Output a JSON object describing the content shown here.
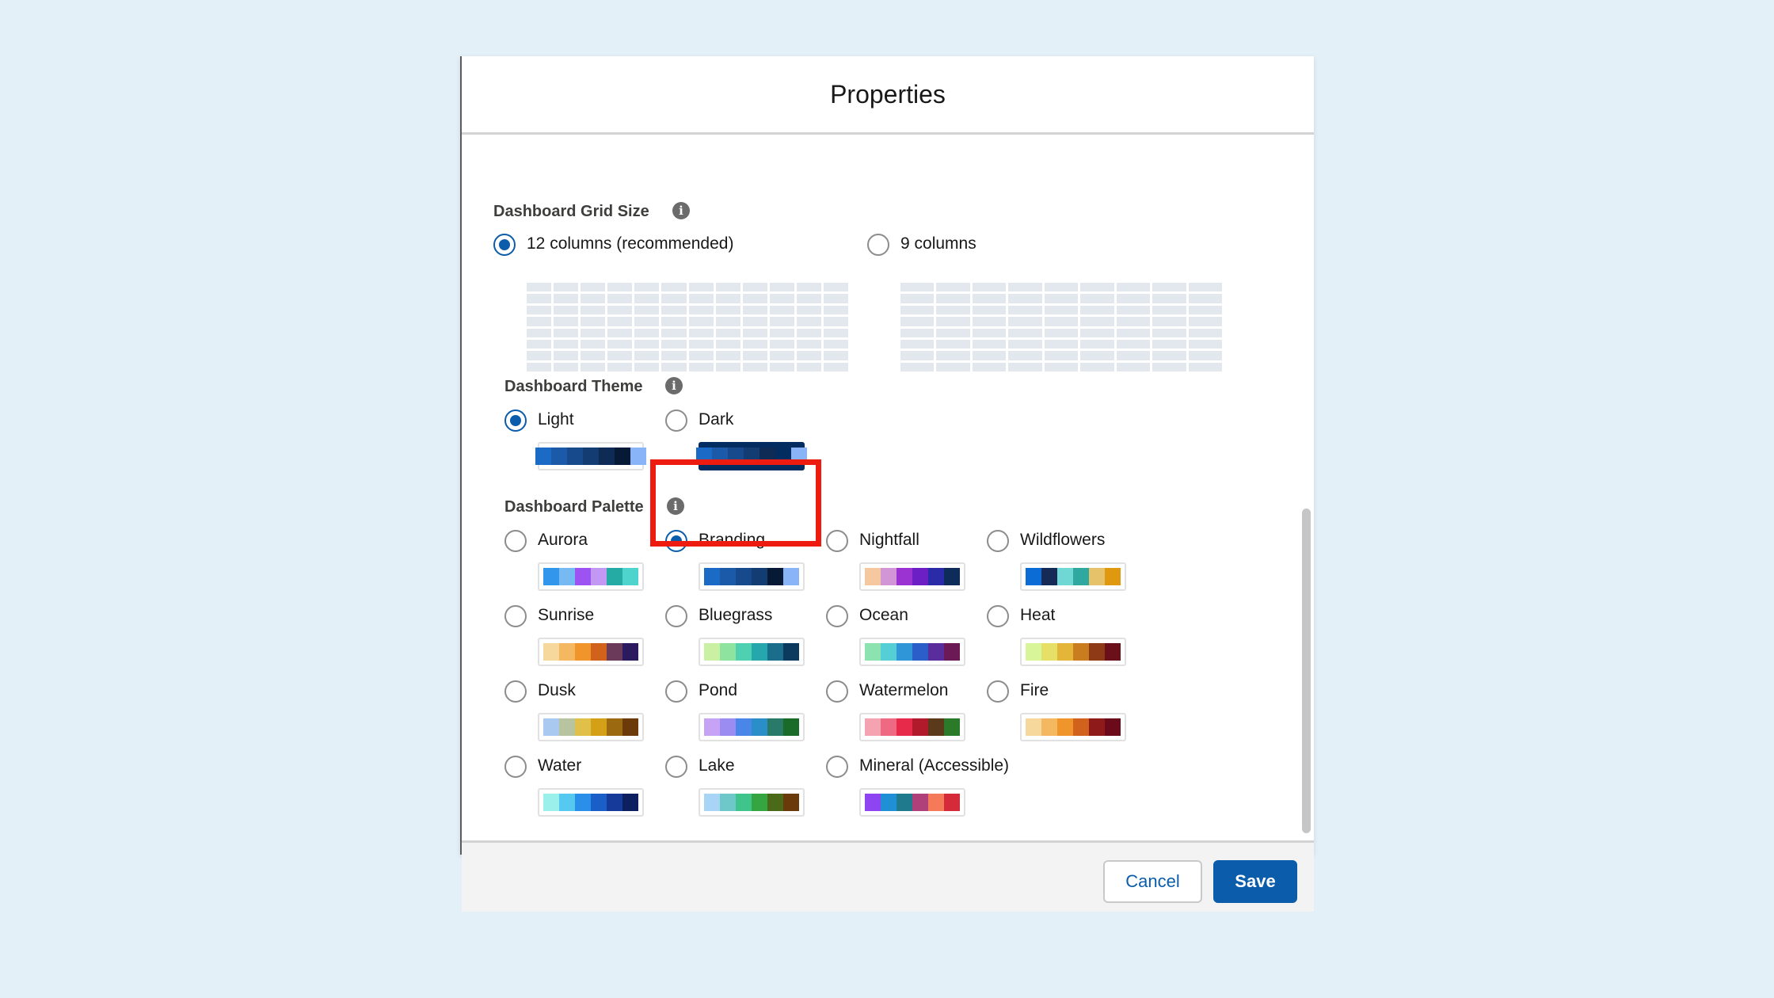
{
  "dialog": {
    "title": "Properties",
    "cancel_label": "Cancel",
    "save_label": "Save"
  },
  "grid_size": {
    "label": "Dashboard Grid Size",
    "info_icon": "info-icon",
    "options": [
      {
        "label": "12 columns (recommended)",
        "selected": true,
        "columns": 12
      },
      {
        "label": "9 columns",
        "selected": false,
        "columns": 9
      }
    ]
  },
  "theme": {
    "label": "Dashboard Theme",
    "options": [
      {
        "label": "Light",
        "selected": true,
        "colors": [
          "#1b6bc6",
          "#1a5aa8",
          "#164a8c",
          "#123c72",
          "#0d2b54",
          "#061a36",
          "#8ab4f8"
        ]
      },
      {
        "label": "Dark",
        "selected": false,
        "colors": [
          "#1b6bc6",
          "#1a5aa8",
          "#164a8c",
          "#123c72",
          "#0d2b54",
          "#032d60",
          "#8ab4f8"
        ]
      }
    ]
  },
  "palette": {
    "label": "Dashboard Palette",
    "options": [
      {
        "label": "Aurora",
        "selected": false,
        "colors": [
          "#3296ed",
          "#77b9f2",
          "#9d53f2",
          "#c398f5",
          "#26aba4",
          "#4ed4cd"
        ]
      },
      {
        "label": "Branding",
        "selected": true,
        "colors": [
          "#1b6bc6",
          "#1a5aa8",
          "#164a8c",
          "#123c72",
          "#061a36",
          "#8ab4f8"
        ]
      },
      {
        "label": "Nightfall",
        "selected": false,
        "colors": [
          "#f6c89f",
          "#d295d6",
          "#9b33d3",
          "#6b1fc4",
          "#2b2aa8",
          "#0e2c5a"
        ]
      },
      {
        "label": "Wildflowers",
        "selected": false,
        "colors": [
          "#0c6cd6",
          "#152a55",
          "#6fd8d4",
          "#2fa89f",
          "#e6c26b",
          "#e0990e"
        ]
      },
      {
        "label": "Sunrise",
        "selected": false,
        "colors": [
          "#f7d89c",
          "#f4b860",
          "#f0952b",
          "#d0621b",
          "#6b3a5a",
          "#2b1a5e"
        ]
      },
      {
        "label": "Bluegrass",
        "selected": false,
        "colors": [
          "#c9f0a3",
          "#8ee39e",
          "#4fd1b1",
          "#26a6ad",
          "#1a6e8c",
          "#0c3a5e"
        ]
      },
      {
        "label": "Ocean",
        "selected": false,
        "colors": [
          "#8de3b0",
          "#55cfd5",
          "#2f96d8",
          "#2b5ec8",
          "#5a2d9c",
          "#6b1a55"
        ]
      },
      {
        "label": "Heat",
        "selected": false,
        "colors": [
          "#d9f59a",
          "#e6e067",
          "#e3b63a",
          "#c97d1f",
          "#8f3a16",
          "#6b0f1a"
        ]
      },
      {
        "label": "Dusk",
        "selected": false,
        "colors": [
          "#a9c9f0",
          "#b8c4a0",
          "#e0c048",
          "#d4a017",
          "#9b6a10",
          "#6b3a08"
        ]
      },
      {
        "label": "Pond",
        "selected": false,
        "colors": [
          "#c7a3f5",
          "#9a8cf0",
          "#4a86e8",
          "#2a8fc9",
          "#2a7a6a",
          "#1a6b2a"
        ]
      },
      {
        "label": "Watermelon",
        "selected": false,
        "colors": [
          "#f5a3b0",
          "#ee6a82",
          "#e82a4a",
          "#b01a2a",
          "#5a3a1a",
          "#2a7a2a"
        ]
      },
      {
        "label": "Fire",
        "selected": false,
        "colors": [
          "#f7d89c",
          "#f4b860",
          "#f0952b",
          "#d0621b",
          "#8f1a1a",
          "#6b0a1a"
        ]
      },
      {
        "label": "Water",
        "selected": false,
        "colors": [
          "#9cf0ec",
          "#55c9ef",
          "#2a8fe8",
          "#1a5ec8",
          "#163a9a",
          "#0c1f5e"
        ]
      },
      {
        "label": "Lake",
        "selected": false,
        "colors": [
          "#a8d4f5",
          "#6ec8c9",
          "#3fc48c",
          "#35a542",
          "#4a6a1a",
          "#6b3a0a"
        ]
      },
      {
        "label": "Mineral (Accessible)",
        "selected": false,
        "colors": [
          "#8e44f0",
          "#1f8fd6",
          "#1e7a8c",
          "#b0407a",
          "#f57a5a",
          "#d42a3a"
        ]
      }
    ]
  }
}
